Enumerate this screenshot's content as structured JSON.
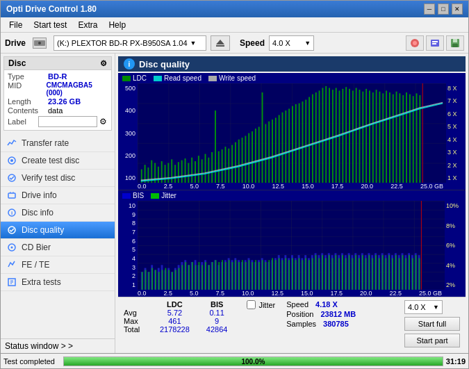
{
  "window": {
    "title": "Opti Drive Control 1.80"
  },
  "menu": {
    "items": [
      "File",
      "Start test",
      "Extra",
      "Help"
    ]
  },
  "drive_bar": {
    "label": "Drive",
    "drive_value": "(K:)  PLEXTOR BD-R  PX-B950SA 1.04",
    "speed_label": "Speed",
    "speed_value": "4.0 X"
  },
  "disc_panel": {
    "title": "Disc",
    "rows": [
      {
        "key": "Type",
        "value": "BD-R"
      },
      {
        "key": "MID",
        "value": "CMCMAGBA5 (000)"
      },
      {
        "key": "Length",
        "value": "23.26 GB"
      },
      {
        "key": "Contents",
        "value": "data"
      },
      {
        "key": "Label",
        "value": ""
      }
    ]
  },
  "nav_items": [
    {
      "id": "transfer-rate",
      "label": "Transfer rate"
    },
    {
      "id": "create-test-disc",
      "label": "Create test disc"
    },
    {
      "id": "verify-test-disc",
      "label": "Verify test disc"
    },
    {
      "id": "drive-info",
      "label": "Drive info"
    },
    {
      "id": "disc-info",
      "label": "Disc info"
    },
    {
      "id": "disc-quality",
      "label": "Disc quality",
      "active": true
    },
    {
      "id": "cd-bier",
      "label": "CD Bier"
    },
    {
      "id": "fe-te",
      "label": "FE / TE"
    },
    {
      "id": "extra-tests",
      "label": "Extra tests"
    }
  ],
  "status_window": {
    "label": "Status window > >"
  },
  "disc_quality": {
    "title": "Disc quality",
    "legend": [
      {
        "label": "LDC",
        "color": "#00aa00"
      },
      {
        "label": "Read speed",
        "color": "#00ffff"
      },
      {
        "label": "Write speed",
        "color": "#ffffff"
      }
    ],
    "legend2": [
      {
        "label": "BIS",
        "color": "#0000ff"
      },
      {
        "label": "Jitter",
        "color": "#00ff00"
      }
    ],
    "upper_y_left": [
      "500",
      "400",
      "300",
      "200",
      "100"
    ],
    "upper_y_right": [
      "8 X",
      "7 X",
      "6 X",
      "5 X",
      "4 X",
      "3 X",
      "2 X",
      "1 X"
    ],
    "lower_y_left": [
      "10",
      "9",
      "8",
      "7",
      "6",
      "5",
      "4",
      "3",
      "2",
      "1"
    ],
    "lower_y_right": [
      "10%",
      "8%",
      "6%",
      "4%",
      "2%"
    ],
    "x_labels": [
      "0.0",
      "2.5",
      "5.0",
      "7.5",
      "10.0",
      "12.5",
      "15.0",
      "17.5",
      "20.0",
      "22.5",
      "25.0 GB"
    ]
  },
  "stats": {
    "headers": [
      "LDC",
      "BIS"
    ],
    "rows": [
      {
        "label": "Avg",
        "ldc": "5.72",
        "bis": "0.11"
      },
      {
        "label": "Max",
        "ldc": "461",
        "bis": "9"
      },
      {
        "label": "Total",
        "ldc": "2178228",
        "bis": "42864"
      }
    ],
    "jitter_label": "Jitter",
    "speed_label": "Speed",
    "speed_value": "4.18 X",
    "speed_dropdown": "4.0 X",
    "position_label": "Position",
    "position_value": "23812 MB",
    "samples_label": "Samples",
    "samples_value": "380785"
  },
  "buttons": {
    "start_full": "Start full",
    "start_part": "Start part"
  },
  "bottom_status": {
    "status": "Test completed",
    "progress": "100.0%",
    "time": "31:19"
  }
}
